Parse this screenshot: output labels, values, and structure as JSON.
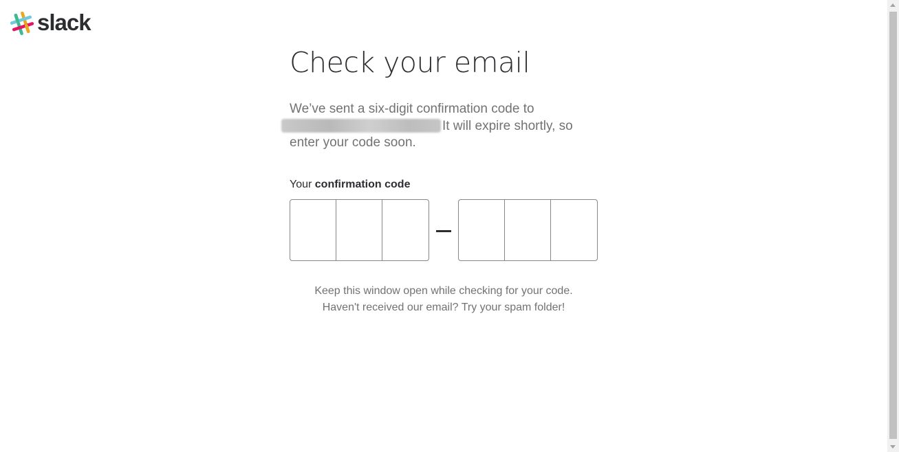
{
  "brand": {
    "name": "slack",
    "logo_icon": "slack-hash-icon",
    "logo_colors": [
      "#3eb991",
      "#e9a820",
      "#e01563",
      "#6ecadc",
      "#2c2d30"
    ]
  },
  "main": {
    "title": "Check your email",
    "desc_line1": "We’ve sent a six-digit confirmation code to",
    "desc_line2": "It will expire shortly, so",
    "desc_line3": "enter your code soon.",
    "code_label_prefix": "Your ",
    "code_label_bold": "confirmation code",
    "code_first_group": [
      "",
      "",
      ""
    ],
    "code_second_group": [
      "",
      "",
      ""
    ],
    "separator": "–",
    "hint_line1": "Keep this window open while checking for your code.",
    "hint_line2": "Haven't received our email? Try your spam folder!"
  },
  "colors": {
    "text_dark": "#2c2d30",
    "text_muted": "#717274",
    "input_border": "#868686"
  }
}
